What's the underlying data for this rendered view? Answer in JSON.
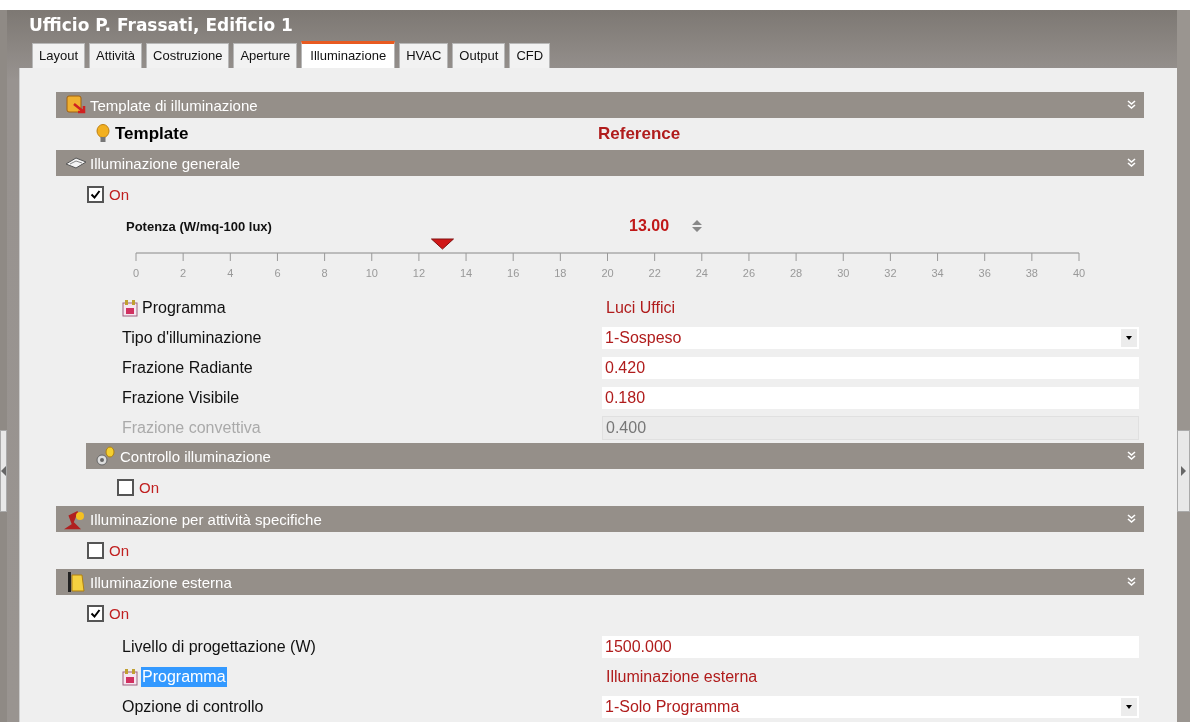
{
  "window": {
    "title": "Ufficio P. Frassati, Edificio 1"
  },
  "tabs": [
    {
      "label": "Layout",
      "selected": false
    },
    {
      "label": "Attività",
      "selected": false
    },
    {
      "label": "Costruzione",
      "selected": false
    },
    {
      "label": "Aperture",
      "selected": false
    },
    {
      "label": "Illuminazione",
      "selected": true
    },
    {
      "label": "HVAC",
      "selected": false
    },
    {
      "label": "Output",
      "selected": false
    },
    {
      "label": "CFD",
      "selected": false
    }
  ],
  "sections": [
    {
      "title": "Template di illuminazione",
      "kind": "template",
      "rows": [
        {
          "kind": "template",
          "label": "Template",
          "value": "Reference"
        }
      ]
    },
    {
      "title": "Illuminazione generale",
      "kind": "lamp",
      "rows": [
        {
          "kind": "toggle",
          "label": "On",
          "checked": true
        },
        {
          "kind": "slider",
          "label": "Potenza (W/mq-100 lux)",
          "value": "13.00",
          "level": 0.325,
          "ticks": [
            "0",
            "2",
            "4",
            "6",
            "8",
            "10",
            "12",
            "14",
            "16",
            "18",
            "20",
            "22",
            "24",
            "26",
            "28",
            "30",
            "32",
            "34",
            "36",
            "38",
            "40"
          ]
        },
        {
          "kind": "link",
          "label": "Programma",
          "value": "Luci Uffici",
          "selected": false
        },
        {
          "kind": "dropdown",
          "label": "Tipo d'illuminazione",
          "value": "1-Sospeso"
        },
        {
          "kind": "input",
          "label": "Frazione Radiante",
          "value": "0.420",
          "disabled": false
        },
        {
          "kind": "input",
          "label": "Frazione Visibile",
          "value": "0.180",
          "disabled": false
        },
        {
          "kind": "input",
          "label": "Frazione convettiva",
          "value": "0.400",
          "disabled": true
        }
      ],
      "children": [
        {
          "title": "Controllo illuminazione",
          "kind": "control",
          "rows": [
            {
              "kind": "toggle",
              "label": "On",
              "checked": false
            }
          ]
        }
      ]
    },
    {
      "title": "Illuminazione per attività specifiche",
      "kind": "task",
      "rows": [
        {
          "kind": "toggle",
          "label": "On",
          "checked": false
        }
      ]
    },
    {
      "title": "Illuminazione esterna",
      "kind": "exterior",
      "rows": [
        {
          "kind": "toggle",
          "label": "On",
          "checked": true
        },
        {
          "kind": "input",
          "label": "Livello di progettazione (W)",
          "value": "1500.000",
          "disabled": false
        },
        {
          "kind": "link",
          "label": "Programma",
          "value": "Illuminazione esterna",
          "selected": true
        },
        {
          "kind": "dropdown",
          "label": "Opzione di controllo",
          "value": "1-Solo Programma"
        }
      ]
    }
  ]
}
